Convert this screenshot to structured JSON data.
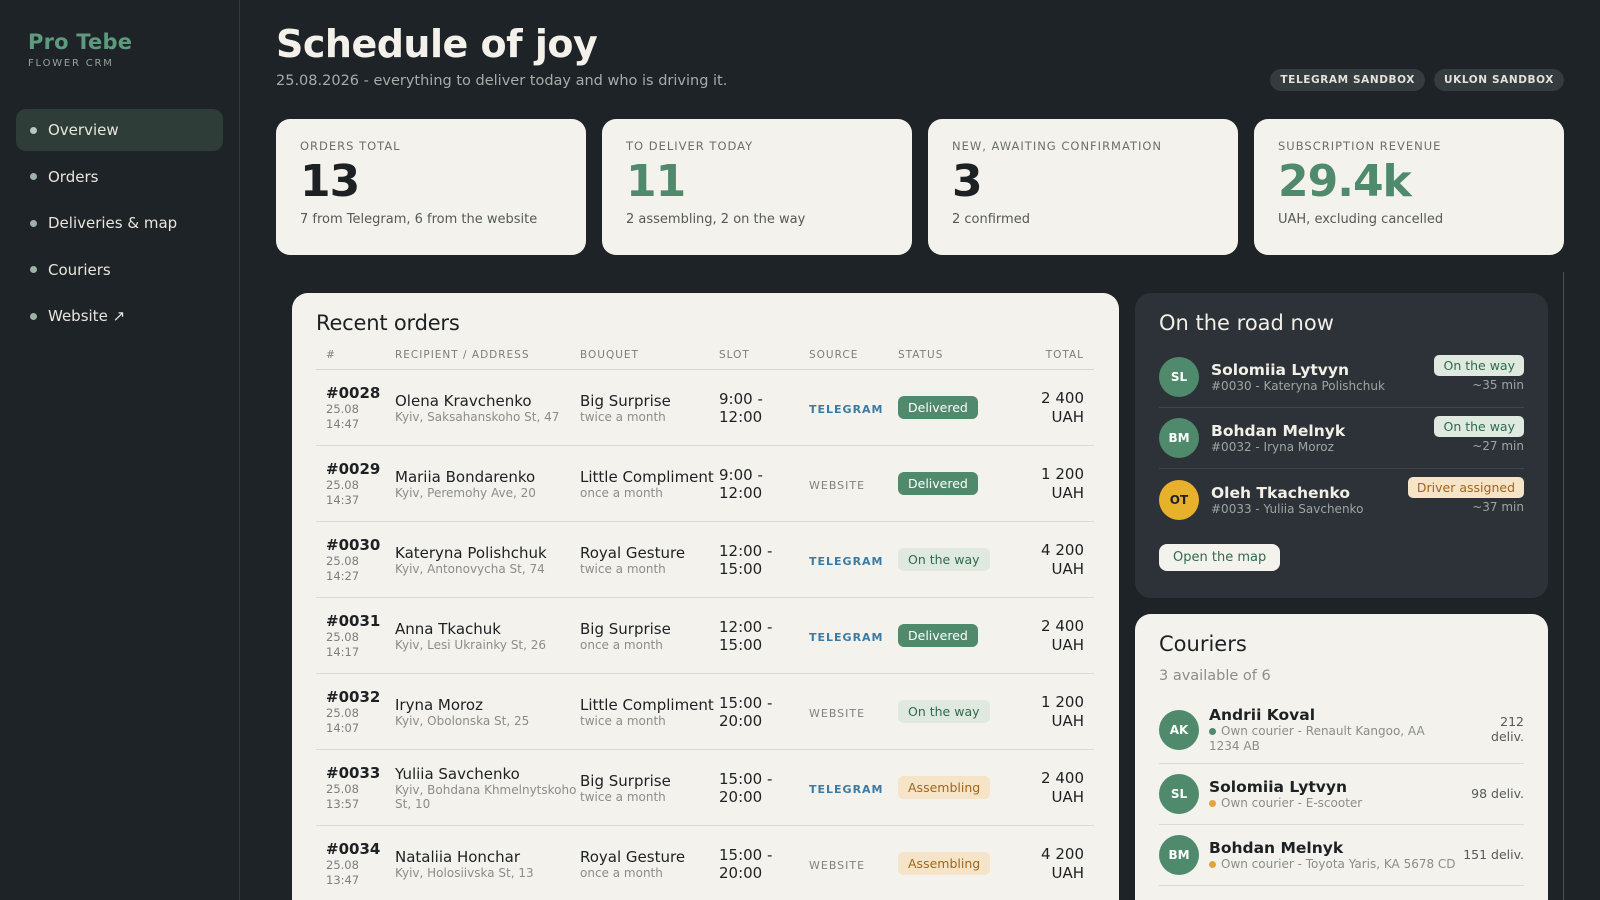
{
  "brand": {
    "name": "Pro Tebe",
    "sub": "FLOWER CRM"
  },
  "nav": [
    {
      "label": "Overview"
    },
    {
      "label": "Orders"
    },
    {
      "label": "Deliveries & map"
    },
    {
      "label": "Couriers"
    },
    {
      "label": "Website ↗"
    }
  ],
  "header": {
    "title": "Schedule of joy",
    "subtitle": "25.08.2026 - everything to deliver today and who is driving it.",
    "badges": [
      "TELEGRAM SANDBOX",
      "UKLON SANDBOX"
    ]
  },
  "stats": [
    {
      "label": "ORDERS TOTAL",
      "value": "13",
      "note": "7 from Telegram, 6 from the website"
    },
    {
      "label": "TO DELIVER TODAY",
      "value": "11",
      "note": "2 assembling, 2 on the way"
    },
    {
      "label": "NEW, AWAITING CONFIRMATION",
      "value": "3",
      "note": "2 confirmed"
    },
    {
      "label": "SUBSCRIPTION REVENUE",
      "value": "29.4k",
      "note": "UAH, excluding cancelled"
    }
  ],
  "orders": {
    "title": "Recent orders",
    "columns": [
      "#",
      "RECIPIENT / ADDRESS",
      "BOUQUET",
      "SLOT",
      "SOURCE",
      "STATUS",
      "TOTAL"
    ],
    "rows": [
      {
        "id": "#0028",
        "date": "25.08",
        "time": "14:47",
        "name": "Olena Kravchenko",
        "addr": "Kyiv, Saksahanskoho St, 47",
        "bouquet": "Big Surprise",
        "freq": "twice a month",
        "slot1": "9:00 -",
        "slot2": "12:00",
        "source": "TELEGRAM",
        "status": "Delivered",
        "total1": "2 400",
        "total2": "UAH"
      },
      {
        "id": "#0029",
        "date": "25.08",
        "time": "14:37",
        "name": "Mariia Bondarenko",
        "addr": "Kyiv, Peremohy Ave, 20",
        "bouquet": "Little Compliment",
        "freq": "once a month",
        "slot1": "9:00 -",
        "slot2": "12:00",
        "source": "WEBSITE",
        "status": "Delivered",
        "total1": "1 200",
        "total2": "UAH"
      },
      {
        "id": "#0030",
        "date": "25.08",
        "time": "14:27",
        "name": "Kateryna Polishchuk",
        "addr": "Kyiv, Antonovycha St, 74",
        "bouquet": "Royal Gesture",
        "freq": "twice a month",
        "slot1": "12:00 -",
        "slot2": "15:00",
        "source": "TELEGRAM",
        "status": "On the way",
        "total1": "4 200",
        "total2": "UAH"
      },
      {
        "id": "#0031",
        "date": "25.08",
        "time": "14:17",
        "name": "Anna Tkachuk",
        "addr": "Kyiv, Lesi Ukrainky St, 26",
        "bouquet": "Big Surprise",
        "freq": "once a month",
        "slot1": "12:00 -",
        "slot2": "15:00",
        "source": "TELEGRAM",
        "status": "Delivered",
        "total1": "2 400",
        "total2": "UAH"
      },
      {
        "id": "#0032",
        "date": "25.08",
        "time": "14:07",
        "name": "Iryna Moroz",
        "addr": "Kyiv, Obolonska St, 25",
        "bouquet": "Little Compliment",
        "freq": "twice a month",
        "slot1": "15:00 -",
        "slot2": "20:00",
        "source": "WEBSITE",
        "status": "On the way",
        "total1": "1 200",
        "total2": "UAH"
      },
      {
        "id": "#0033",
        "date": "25.08",
        "time": "13:57",
        "name": "Yuliia Savchenko",
        "addr": "Kyiv, Bohdana Khmelnytskoho St, 10",
        "bouquet": "Big Surprise",
        "freq": "twice a month",
        "slot1": "15:00 -",
        "slot2": "20:00",
        "source": "TELEGRAM",
        "status": "Assembling",
        "total1": "2 400",
        "total2": "UAH"
      },
      {
        "id": "#0034",
        "date": "25.08",
        "time": "13:47",
        "name": "Nataliia Honchar",
        "addr": "Kyiv, Holosiivska St, 13",
        "bouquet": "Royal Gesture",
        "freq": "once a month",
        "slot1": "15:00 -",
        "slot2": "20:00",
        "source": "WEBSITE",
        "status": "Assembling",
        "total1": "4 200",
        "total2": "UAH"
      }
    ]
  },
  "road": {
    "title": "On the road now",
    "items": [
      {
        "initials": "SL",
        "name": "Solomiia Lytvyn",
        "sub": "#0030 - Kateryna Polishchuk",
        "status": "On the way",
        "eta": "~35 min"
      },
      {
        "initials": "BM",
        "name": "Bohdan Melnyk",
        "sub": "#0032 - Iryna Moroz",
        "status": "On the way",
        "eta": "~27 min"
      },
      {
        "initials": "OT",
        "name": "Oleh Tkachenko",
        "sub": "#0033 - Yuliia Savchenko",
        "status": "Driver assigned",
        "eta": "~37 min"
      }
    ],
    "button": "Open the map"
  },
  "couriers": {
    "title": "Couriers",
    "sub": "3 available of 6",
    "items": [
      {
        "initials": "AK",
        "name": "Andrii Koval",
        "sub": "Own courier - Renault Kangoo, AA 1234 AB",
        "deliv1": "212",
        "deliv2": "deliv."
      },
      {
        "initials": "SL",
        "name": "Solomiia Lytvyn",
        "sub": "Own courier - E-scooter",
        "deliv1": "98 deliv.",
        "deliv2": ""
      },
      {
        "initials": "BM",
        "name": "Bohdan Melnyk",
        "sub": "Own courier - Toyota Yaris, KA 5678 CD",
        "deliv1": "151 deliv.",
        "deliv2": ""
      }
    ]
  },
  "colors": {
    "accent": "#4f8a6c",
    "background": "#1e2327",
    "card": "#f4f2ec",
    "warning": "#e6a23c"
  }
}
